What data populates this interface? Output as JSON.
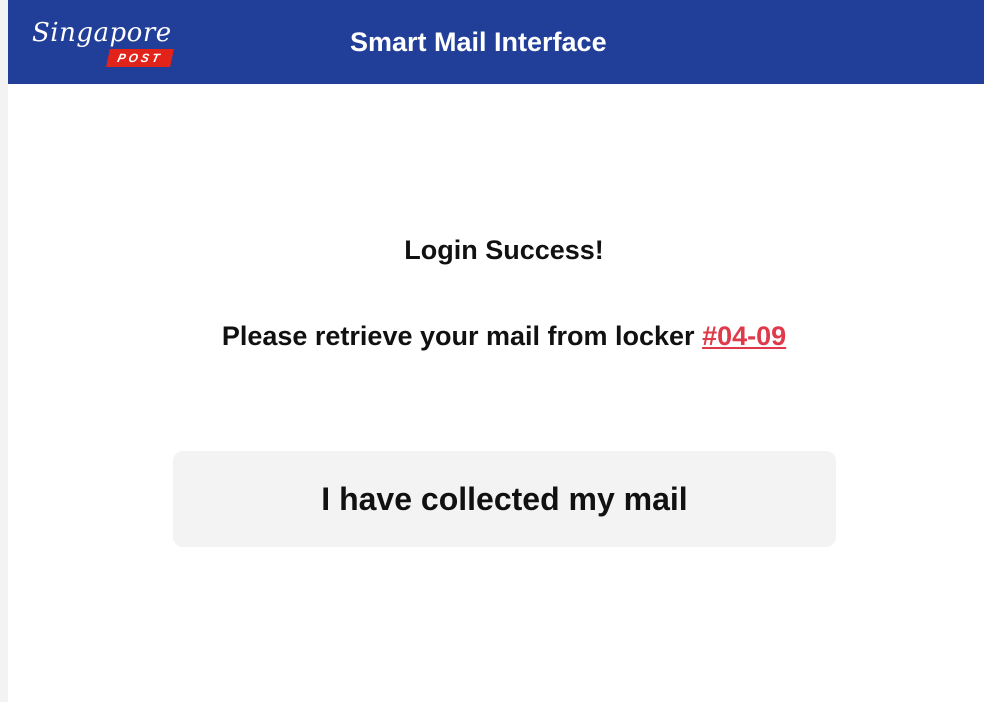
{
  "header": {
    "logo": {
      "script_text": "Singapore",
      "badge_text": "POST"
    },
    "title": "Smart Mail Interface"
  },
  "main": {
    "success_message": "Login Success!",
    "retrieve_prefix": "Please retrieve your mail from locker ",
    "locker_number": "#04-09",
    "collect_button_label": "I have collected my mail"
  },
  "colors": {
    "header_bg": "#213f99",
    "locker_link": "#e03a4a",
    "logo_badge": "#e2231a",
    "button_bg": "#f3f3f3"
  }
}
